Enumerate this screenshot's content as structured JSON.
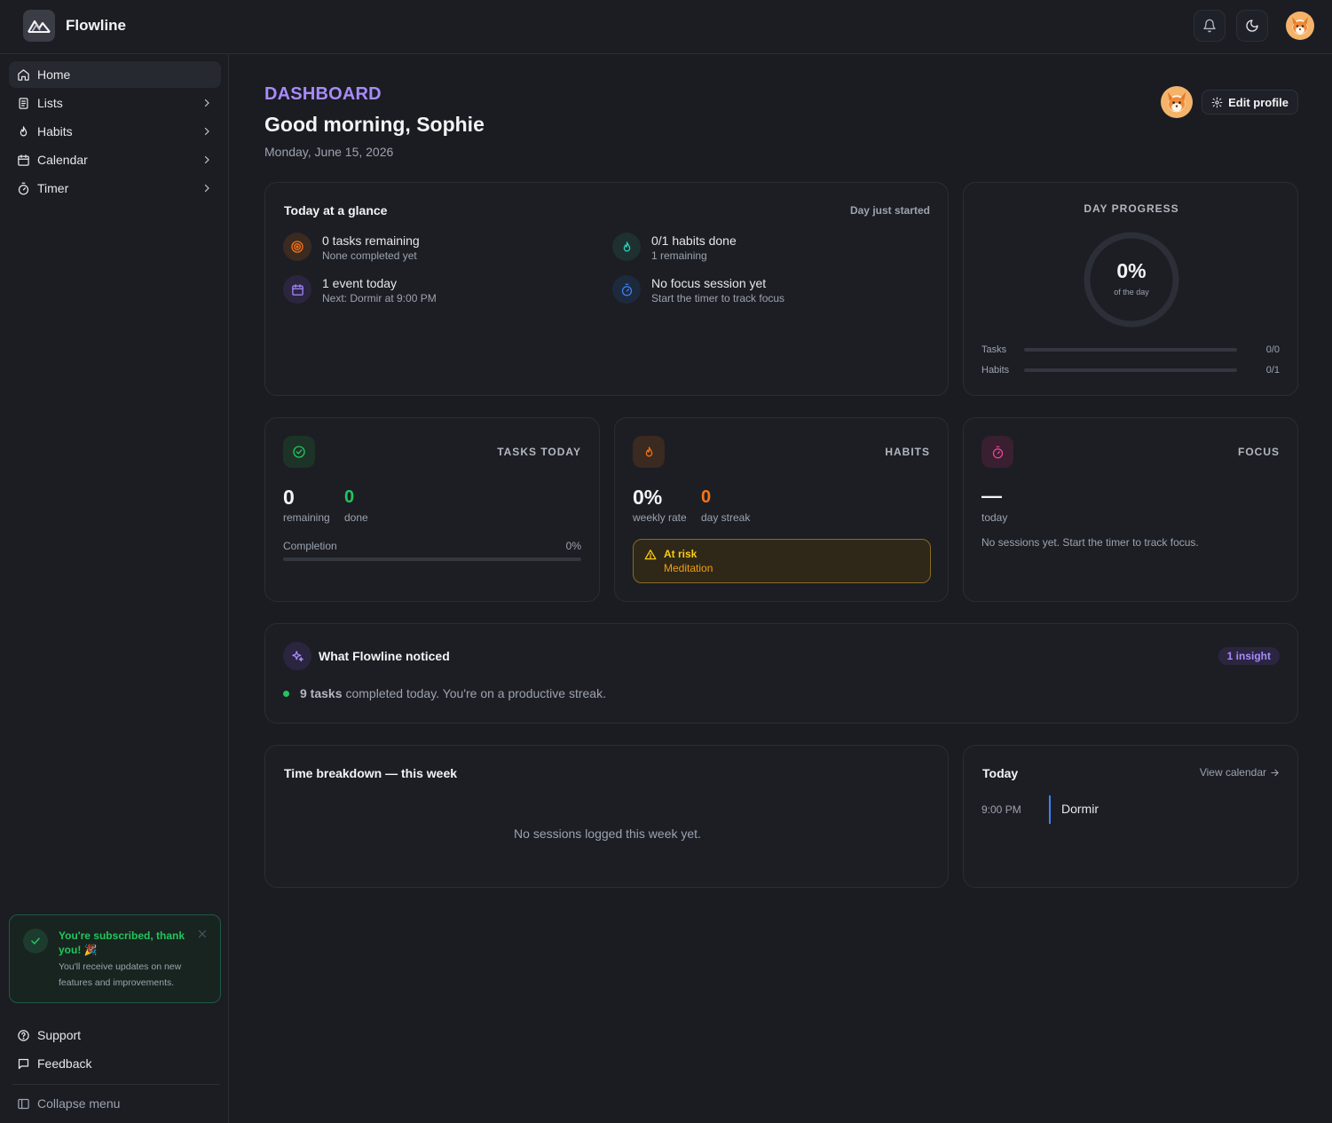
{
  "app": {
    "name": "Flowline"
  },
  "sidebar": {
    "items": [
      {
        "label": "Home"
      },
      {
        "label": "Lists"
      },
      {
        "label": "Habits"
      },
      {
        "label": "Calendar"
      },
      {
        "label": "Timer"
      }
    ],
    "toast": {
      "title": "You're subscribed, thank you! 🎉",
      "body": "You'll receive updates on new features and improvements."
    },
    "support_label": "Support",
    "feedback_label": "Feedback",
    "collapse_label": "Collapse menu"
  },
  "header": {
    "eyebrow": "DASHBOARD",
    "greeting": "Good morning, Sophie",
    "date": "Monday, June 15, 2026",
    "edit_profile_label": "Edit profile"
  },
  "glance": {
    "title": "Today at a glance",
    "status": "Day just started",
    "items": [
      {
        "title": "0 tasks remaining",
        "sub": "None completed yet",
        "icon": "target-icon"
      },
      {
        "title": "0/1 habits done",
        "sub": "1 remaining",
        "icon": "flame-icon"
      },
      {
        "title": "1 event today",
        "sub": "Next: Dormir at 9:00 PM",
        "icon": "calendar-icon"
      },
      {
        "title": "No focus session yet",
        "sub": "Start the timer to track focus",
        "icon": "timer-icon"
      }
    ]
  },
  "day_progress": {
    "label": "DAY PROGRESS",
    "value": "0%",
    "value_fraction": 0,
    "sub": "of the day",
    "rows": [
      {
        "label": "Tasks",
        "value": "0/0",
        "fraction": 0
      },
      {
        "label": "Habits",
        "value": "0/1",
        "fraction": 0
      }
    ]
  },
  "tasks_today": {
    "label": "TASKS TODAY",
    "remaining_value": "0",
    "remaining_label": "remaining",
    "done_value": "0",
    "done_label": "done",
    "completion_label": "Completion",
    "completion_value": "0%",
    "completion_fraction": 0
  },
  "habits": {
    "label": "HABITS",
    "rate_value": "0%",
    "rate_label": "weekly rate",
    "streak_value": "0",
    "streak_label": "day streak",
    "risk_title": "At risk",
    "risk_habit": "Meditation"
  },
  "focus": {
    "label": "FOCUS",
    "value": "—",
    "value_label": "today",
    "message": "No sessions yet. Start the timer to track focus."
  },
  "insights": {
    "title": "What Flowline noticed",
    "badge": "1 insight",
    "items": [
      {
        "bold": "9 tasks",
        "text": "completed today. You're on a productive streak."
      }
    ]
  },
  "time_breakdown": {
    "title": "Time breakdown — this week",
    "empty": "No sessions logged this week yet."
  },
  "today": {
    "title": "Today",
    "view_calendar": "View calendar",
    "events": [
      {
        "time": "9:00 PM",
        "name": "Dormir"
      }
    ]
  },
  "colors": {
    "accent": "#a78bfa",
    "success": "#22c55e",
    "warning": "#facc15",
    "orange": "#f97316",
    "blue": "#3b82f6",
    "pink": "#ec4899"
  }
}
